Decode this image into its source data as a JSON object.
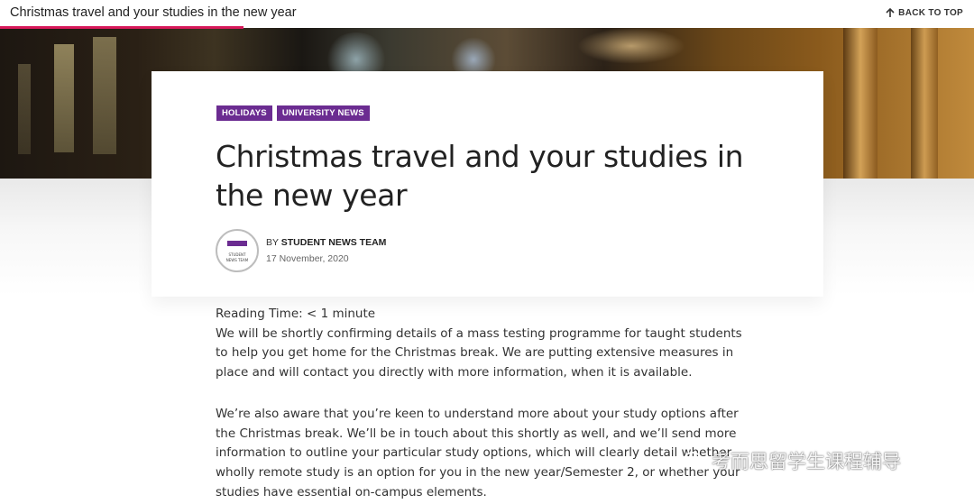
{
  "topbar": {
    "title": "Christmas travel and your studies in the new year",
    "back_to_top": "BACK TO TOP",
    "progress_fraction": 0.25
  },
  "article": {
    "tags": [
      "HOLIDAYS",
      "UNIVERSITY NEWS"
    ],
    "headline": "Christmas travel and your studies in the new year",
    "author_prefix": "BY",
    "author": "STUDENT NEWS TEAM",
    "avatar_text_line1": "STUDENT",
    "avatar_text_line2": "NEWS TEAM",
    "date": "17 November, 2020",
    "reading_time": "Reading Time: < 1 minute",
    "paragraph1": "We will be shortly confirming details of a mass testing programme for taught students to help you get home for the Christmas break.  We are putting extensive measures in place and will contact you directly with more information, when it is available.",
    "paragraph2": "We’re also aware that you’re keen to understand more about your study options after the Christmas break. We’ll be in touch about this shortly as well, and we’ll send more information to outline your particular study options, which will clearly detail whether wholly remote study is an option for you in the new year/Semester 2, or whether your studies have essential on-campus elements."
  },
  "watermark": {
    "text": "考而思留学生课程辅导"
  },
  "colors": {
    "accent": "#d7195a",
    "tag": "#6b2c91"
  },
  "icons": {
    "back_to_top": "arrow-up-icon",
    "watermark": "wechat-icon"
  }
}
